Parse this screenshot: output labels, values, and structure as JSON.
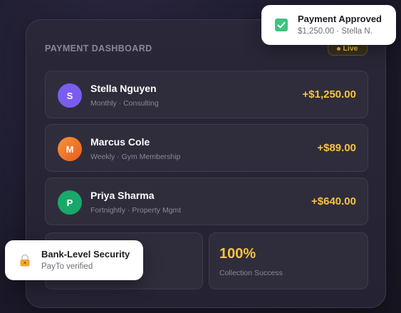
{
  "panel": {
    "title": "PAYMENT DASHBOARD",
    "live_label": "Live"
  },
  "payments": [
    {
      "initial": "S",
      "name": "Stella Nguyen",
      "meta": "Monthly · Consulting",
      "amount": "+$1,250.00",
      "avatar_color": "#7b5cf0"
    },
    {
      "initial": "M",
      "name": "Marcus Cole",
      "meta": "Weekly · Gym Membership",
      "amount": "+$89.00",
      "avatar_color": "#f07a28"
    },
    {
      "initial": "P",
      "name": "Priya Sharma",
      "meta": "Fortnightly · Property Mgmt",
      "amount": "+$640.00",
      "avatar_color": "#19a86a"
    }
  ],
  "stats": {
    "collection_value": "100%",
    "collection_label": "Collection Success"
  },
  "toasts": {
    "approved": {
      "title": "Payment Approved",
      "subtitle": "$1,250.00 · Stella N.",
      "icon": "check-icon",
      "icon_color": "#3dc47e"
    },
    "security": {
      "title": "Bank-Level Security",
      "subtitle": "PayTo verified",
      "icon": "lock-icon",
      "icon_color": "#f0a531"
    }
  },
  "colors": {
    "accent": "#f5c342",
    "background": "#1d1b2e",
    "panel": "#2a2838"
  }
}
